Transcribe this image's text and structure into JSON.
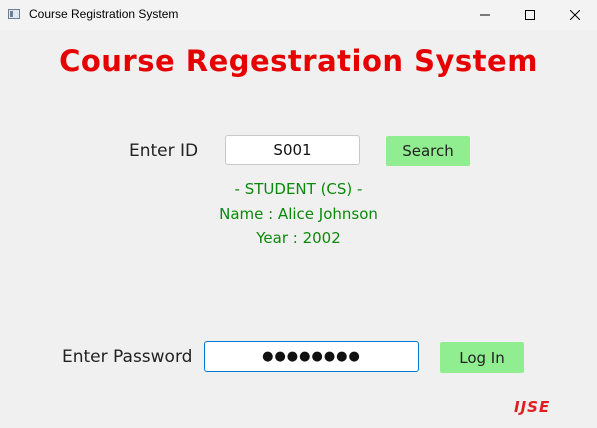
{
  "window": {
    "title": "Course Registration System",
    "icons": {
      "app": "app-icon",
      "minimize": "minimize-icon",
      "maximize": "maximize-icon",
      "close": "close-icon"
    }
  },
  "header": {
    "title": "Course Regestration System"
  },
  "search": {
    "label": "Enter ID",
    "id_value": "S001",
    "button_label": "Search"
  },
  "student": {
    "type_line": "- STUDENT (CS) -",
    "name_line": "Name : Alice Johnson",
    "year_line": "Year : 2002"
  },
  "login": {
    "label": "Enter Password",
    "password_value": "●●●●●●●●",
    "button_label": "Log In"
  },
  "logo": {
    "text": "IJSE"
  },
  "colors": {
    "title": "#e60000",
    "info": "#0a8a0a",
    "button": "#90ee90",
    "focus_border": "#0078d4",
    "logo": "#e02020"
  }
}
